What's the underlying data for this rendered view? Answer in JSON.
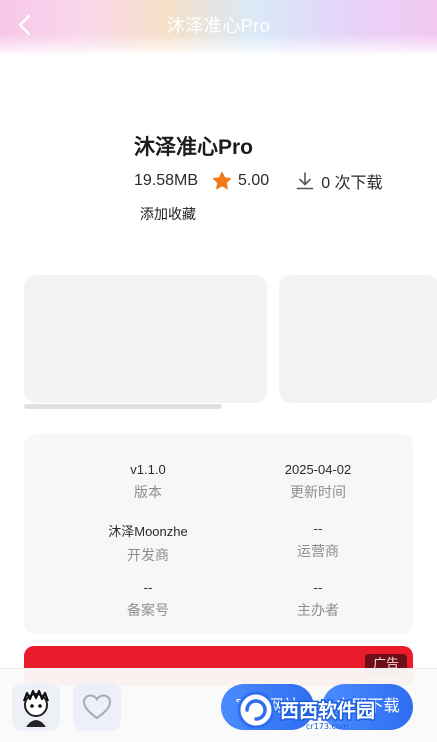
{
  "header": {
    "title": "沐泽准心Pro"
  },
  "app": {
    "name": "沐泽准心Pro",
    "size": "19.58MB",
    "rating": "5.00",
    "downloads": "0 次下载",
    "favorite_label": "添加收藏"
  },
  "info": {
    "version_value": "v1.1.0",
    "version_label": "版本",
    "updated_value": "2025-04-02",
    "updated_label": "更新时间",
    "developer_value": "沐泽Moonzhe",
    "developer_label": "开发商",
    "operator_value": "--",
    "operator_label": "运营商",
    "filing_value": "--",
    "filing_label": "备案号",
    "sponsor_value": "--",
    "sponsor_label": "主办者"
  },
  "ad": {
    "tag": "广告"
  },
  "bottom": {
    "official_label": "官方网站",
    "download_label": "立即下载"
  },
  "watermark": {
    "cn": "西西软件园",
    "site": "cr173.com"
  },
  "colors": {
    "accent_blue": "#3a7cf7",
    "star_orange": "#f07a1a",
    "ad_red": "#ea1c2c"
  },
  "icons": {
    "back": "chevron-left-icon",
    "rating": "star-icon",
    "downloads": "download-icon",
    "favorite": "heart-icon"
  }
}
